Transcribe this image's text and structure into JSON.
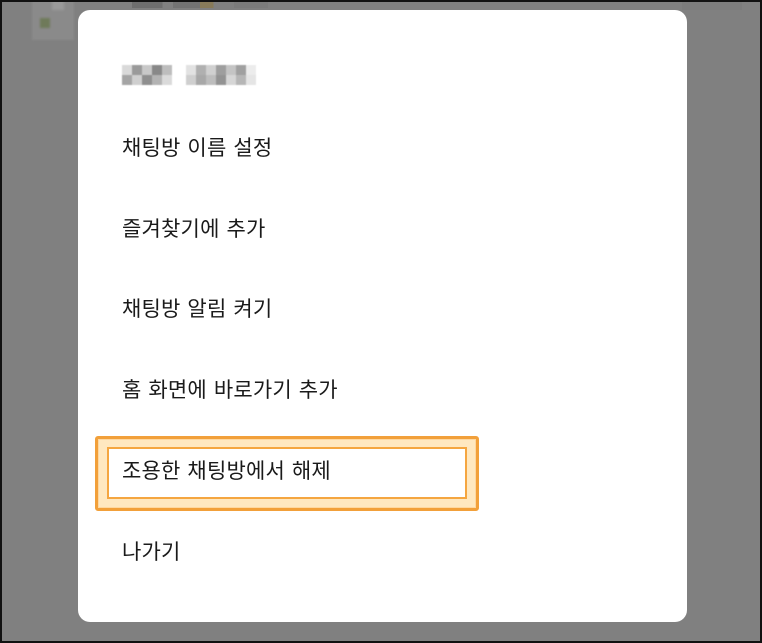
{
  "dialog": {
    "title_redacted": true,
    "menu": [
      {
        "id": "rename",
        "label": "채팅방 이름 설정"
      },
      {
        "id": "favorite",
        "label": "즐겨찾기에 추가"
      },
      {
        "id": "notify",
        "label": "채팅방 알림 켜기"
      },
      {
        "id": "shortcut",
        "label": "홈 화면에 바로가기 추가"
      },
      {
        "id": "quiet",
        "label": "조용한 채팅방에서 해제"
      },
      {
        "id": "leave",
        "label": "나가기"
      }
    ]
  },
  "colors": {
    "overlay": "#808080",
    "dialog_bg": "#ffffff",
    "text": "#1a1a1a",
    "highlight_border": "#f2a03a",
    "highlight_fill": "#ffd68c"
  }
}
